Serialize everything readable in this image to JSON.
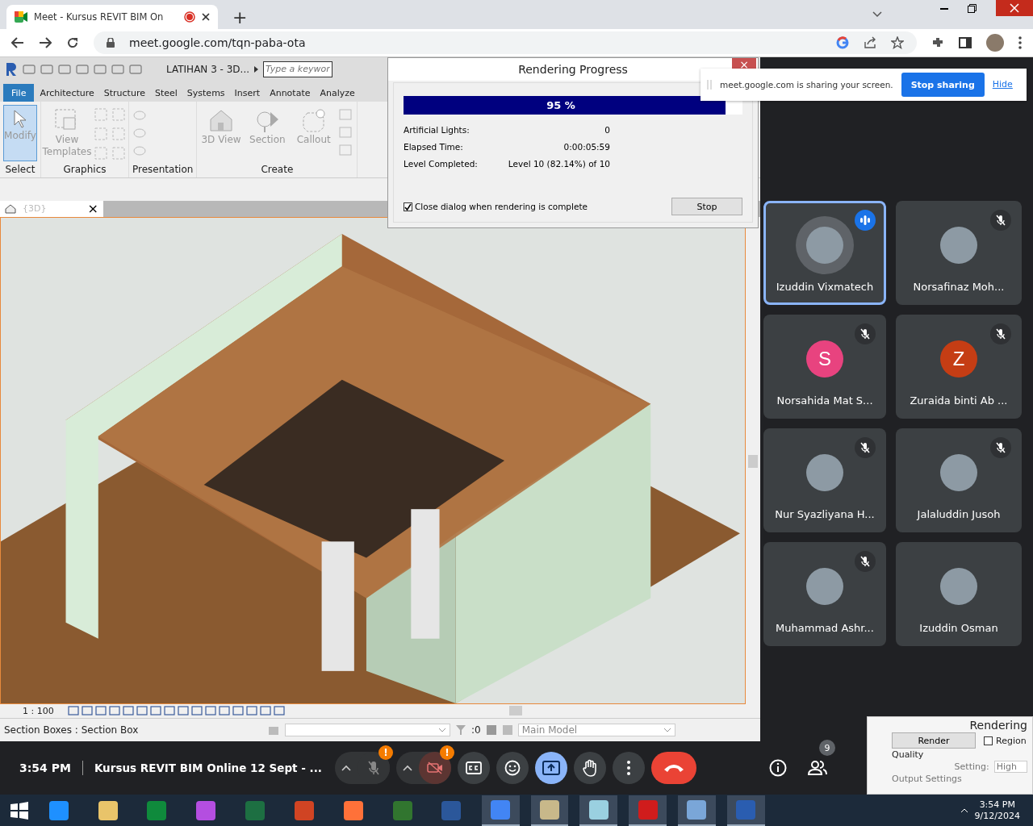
{
  "browser": {
    "tab_title": "Meet - Kursus REVIT BIM On",
    "new_tab": "+",
    "url": "meet.google.com/tqn-paba-ota"
  },
  "revit": {
    "project_title": "LATIHAN 3 - 3D...",
    "search": {
      "placeholder": "Type a keywor"
    },
    "tabs": [
      {
        "label": "File",
        "selected": true
      },
      {
        "label": "Architecture",
        "selected": false
      },
      {
        "label": "Structure",
        "selected": false
      },
      {
        "label": "Steel",
        "selected": false
      },
      {
        "label": "Systems",
        "selected": false
      },
      {
        "label": "Insert",
        "selected": false
      },
      {
        "label": "Annotate",
        "selected": false
      },
      {
        "label": "Analyze",
        "selected": false
      }
    ],
    "panels": [
      {
        "title": "Select",
        "tools": [
          {
            "kind": "pointer",
            "label": "Modify",
            "selected": true
          }
        ]
      },
      {
        "title": "Graphics",
        "tools": [
          {
            "kind": "templates",
            "label": "View Templates",
            "selected": false
          }
        ]
      },
      {
        "title": "Presentation"
      },
      {
        "title": "Create",
        "tools": [
          {
            "kind": "house",
            "label": "3D View",
            "selected": false
          },
          {
            "kind": "section",
            "label": "Section",
            "selected": false
          },
          {
            "kind": "callout",
            "label": "Callout",
            "selected": false
          }
        ]
      }
    ],
    "view_tab": {
      "label": "{3D}",
      "close": "×"
    },
    "scale": "1 : 100",
    "status": "Section Boxes : Section Box",
    "workset_count": ":0",
    "model": "Main Model"
  },
  "render_dialog": {
    "title": "Rendering Progress",
    "close": "×",
    "level": 0.95,
    "percent": "95 %",
    "rows": [
      {
        "label": "Artificial Lights:",
        "value": "0"
      },
      {
        "label": "Elapsed Time:",
        "value": "0:00:05:59"
      },
      {
        "label": "Level Completed:",
        "value": "Level 10 (82.14%) of 10"
      }
    ],
    "close_when_done": {
      "label": "Close dialog when rendering is complete",
      "checked": true
    },
    "stop": "Stop"
  },
  "share_bar": {
    "message": "meet.google.com is sharing your screen.",
    "stop": "Stop sharing",
    "hide": "Hide"
  },
  "participants": [
    {
      "name": "Izuddin Vixmatech",
      "kind": "photo",
      "selected": true,
      "speaking": true,
      "muted": false
    },
    {
      "name": "Norsafinaz Moh...",
      "kind": "photo",
      "selected": false,
      "speaking": false,
      "muted": true
    },
    {
      "name": "Norsahida Mat S...",
      "kind": "letter",
      "letter": "S",
      "color": "#e8437f",
      "selected": false,
      "speaking": false,
      "muted": true
    },
    {
      "name": "Zuraida binti Ab ...",
      "kind": "letter",
      "letter": "Z",
      "color": "#c53d14",
      "selected": false,
      "speaking": false,
      "muted": true
    },
    {
      "name": "Nur Syazliyana H...",
      "kind": "photo",
      "selected": false,
      "speaking": false,
      "muted": true
    },
    {
      "name": "Jalaluddin Jusoh",
      "kind": "photo",
      "selected": false,
      "speaking": false,
      "muted": true
    },
    {
      "name": "Muhammad Ashr...",
      "kind": "photo",
      "selected": false,
      "speaking": false,
      "muted": true
    },
    {
      "name": "Izuddin Osman",
      "kind": "photo",
      "selected": false,
      "speaking": false,
      "muted": false
    }
  ],
  "meeting_bar": {
    "time": "3:54 PM",
    "title": "Kursus REVIT BIM Online 12 Sept - ...",
    "mic": {
      "off": true,
      "badge": "!"
    },
    "camera": {
      "off": true,
      "badge": "!"
    },
    "controls": [
      {
        "kind": "captions",
        "active": false
      },
      {
        "kind": "emoji",
        "active": false
      },
      {
        "kind": "present",
        "active": true
      },
      {
        "kind": "hand",
        "active": false
      },
      {
        "kind": "more",
        "active": false
      },
      {
        "kind": "end",
        "active": false
      }
    ],
    "people_count": "9"
  },
  "render_panel": {
    "title": "Rendering",
    "render": "Render",
    "region": {
      "label": "Region",
      "checked": false
    },
    "quality": "Quality",
    "setting_label": "Setting:",
    "setting_value": "High",
    "output": "Output Settings"
  },
  "taskbar": {
    "time": "3:54 PM",
    "date": "9/12/2024"
  }
}
